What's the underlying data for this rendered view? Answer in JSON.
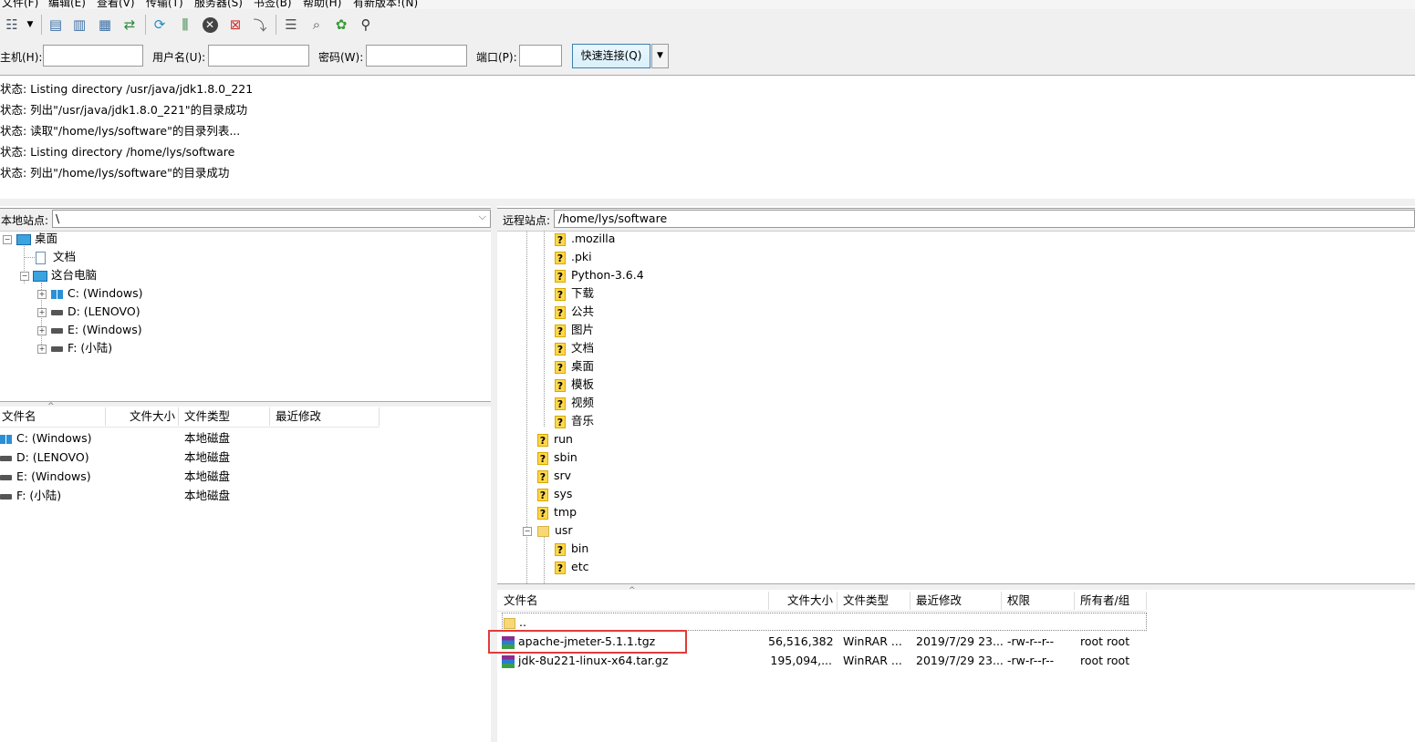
{
  "menu": [
    "文件(F)",
    "编辑(E)",
    "查看(V)",
    "传输(T)",
    "服务器(S)",
    "书签(B)",
    "帮助(H)",
    "有新版本!(N)"
  ],
  "quickconnect": {
    "host_label": "主机(H):",
    "user_label": "用户名(U):",
    "pass_label": "密码(W):",
    "port_label": "端口(P):",
    "button_label": "快速连接(Q)"
  },
  "log": [
    "状态: Listing directory /usr/java/jdk1.8.0_221",
    "状态: 列出\"/usr/java/jdk1.8.0_221\"的目录成功",
    "状态: 读取\"/home/lys/software\"的目录列表...",
    "状态: Listing directory /home/lys/software",
    "状态: 列出\"/home/lys/software\"的目录成功"
  ],
  "local": {
    "site_label": "本地站点:",
    "path": "\\",
    "tree": {
      "desktop": "桌面",
      "documents": "文档",
      "this_pc": "这台电脑",
      "drives": [
        "C: (Windows)",
        "D: (LENOVO)",
        "E: (Windows)",
        "F: (小陆)"
      ]
    },
    "columns": [
      "文件名",
      "文件大小",
      "文件类型",
      "最近修改"
    ],
    "files": [
      {
        "name": "C: (Windows)",
        "type": "本地磁盘"
      },
      {
        "name": "D: (LENOVO)",
        "type": "本地磁盘"
      },
      {
        "name": "E: (Windows)",
        "type": "本地磁盘"
      },
      {
        "name": "F: (小陆)",
        "type": "本地磁盘"
      }
    ]
  },
  "remote": {
    "site_label": "远程站点:",
    "path": "/home/lys/software",
    "tree_level2": [
      ".mozilla",
      ".pki",
      "Python-3.6.4",
      "下载",
      "公共",
      "图片",
      "文档",
      "桌面",
      "模板",
      "视频",
      "音乐"
    ],
    "tree_level1": [
      "run",
      "sbin",
      "srv",
      "sys",
      "tmp",
      "usr"
    ],
    "tree_usr_children": [
      "bin",
      "etc"
    ],
    "columns": [
      "文件名",
      "文件大小",
      "文件类型",
      "最近修改",
      "权限",
      "所有者/组"
    ],
    "parent_dir": "..",
    "files": [
      {
        "name": "apache-jmeter-5.1.1.tgz",
        "size": "56,516,382",
        "type": "WinRAR ...",
        "modified": "2019/7/29 23...",
        "perms": "-rw-r--r--",
        "owner": "root root"
      },
      {
        "name": "jdk-8u221-linux-x64.tar.gz",
        "size": "195,094,...",
        "type": "WinRAR ...",
        "modified": "2019/7/29 23...",
        "perms": "-rw-r--r--",
        "owner": "root root"
      }
    ]
  },
  "colors": {
    "highlight": "#e03b3b",
    "quickconnect_border": "#3c7fb1"
  }
}
